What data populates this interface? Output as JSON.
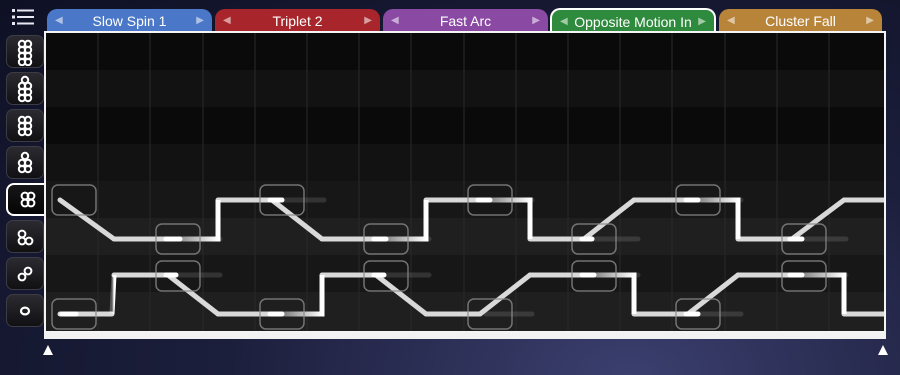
{
  "toolbar": {
    "menu_icon": "hamburger-menu-icon"
  },
  "tabs": [
    {
      "label": "Slow Spin 1",
      "color": "#4a77c7"
    },
    {
      "label": "Triplet 2",
      "color": "#a8262b"
    },
    {
      "label": "Fast Arc",
      "color": "#8a4aa4"
    },
    {
      "label": "Opposite Motion In",
      "color": "#2e8a3c",
      "selected": true
    },
    {
      "label": "Cluster Fall",
      "color": "#b8843a"
    }
  ],
  "sidebar": [
    {
      "icon": "ball-stack-8-icon"
    },
    {
      "icon": "ball-stack-7-icon"
    },
    {
      "icon": "ball-stack-6-icon"
    },
    {
      "icon": "ball-stack-5-icon"
    },
    {
      "icon": "ball-stack-4-icon",
      "selected": true
    },
    {
      "icon": "ball-stack-3-icon"
    },
    {
      "icon": "ball-stack-2-icon"
    },
    {
      "icon": "ball-stack-1-icon"
    }
  ]
}
